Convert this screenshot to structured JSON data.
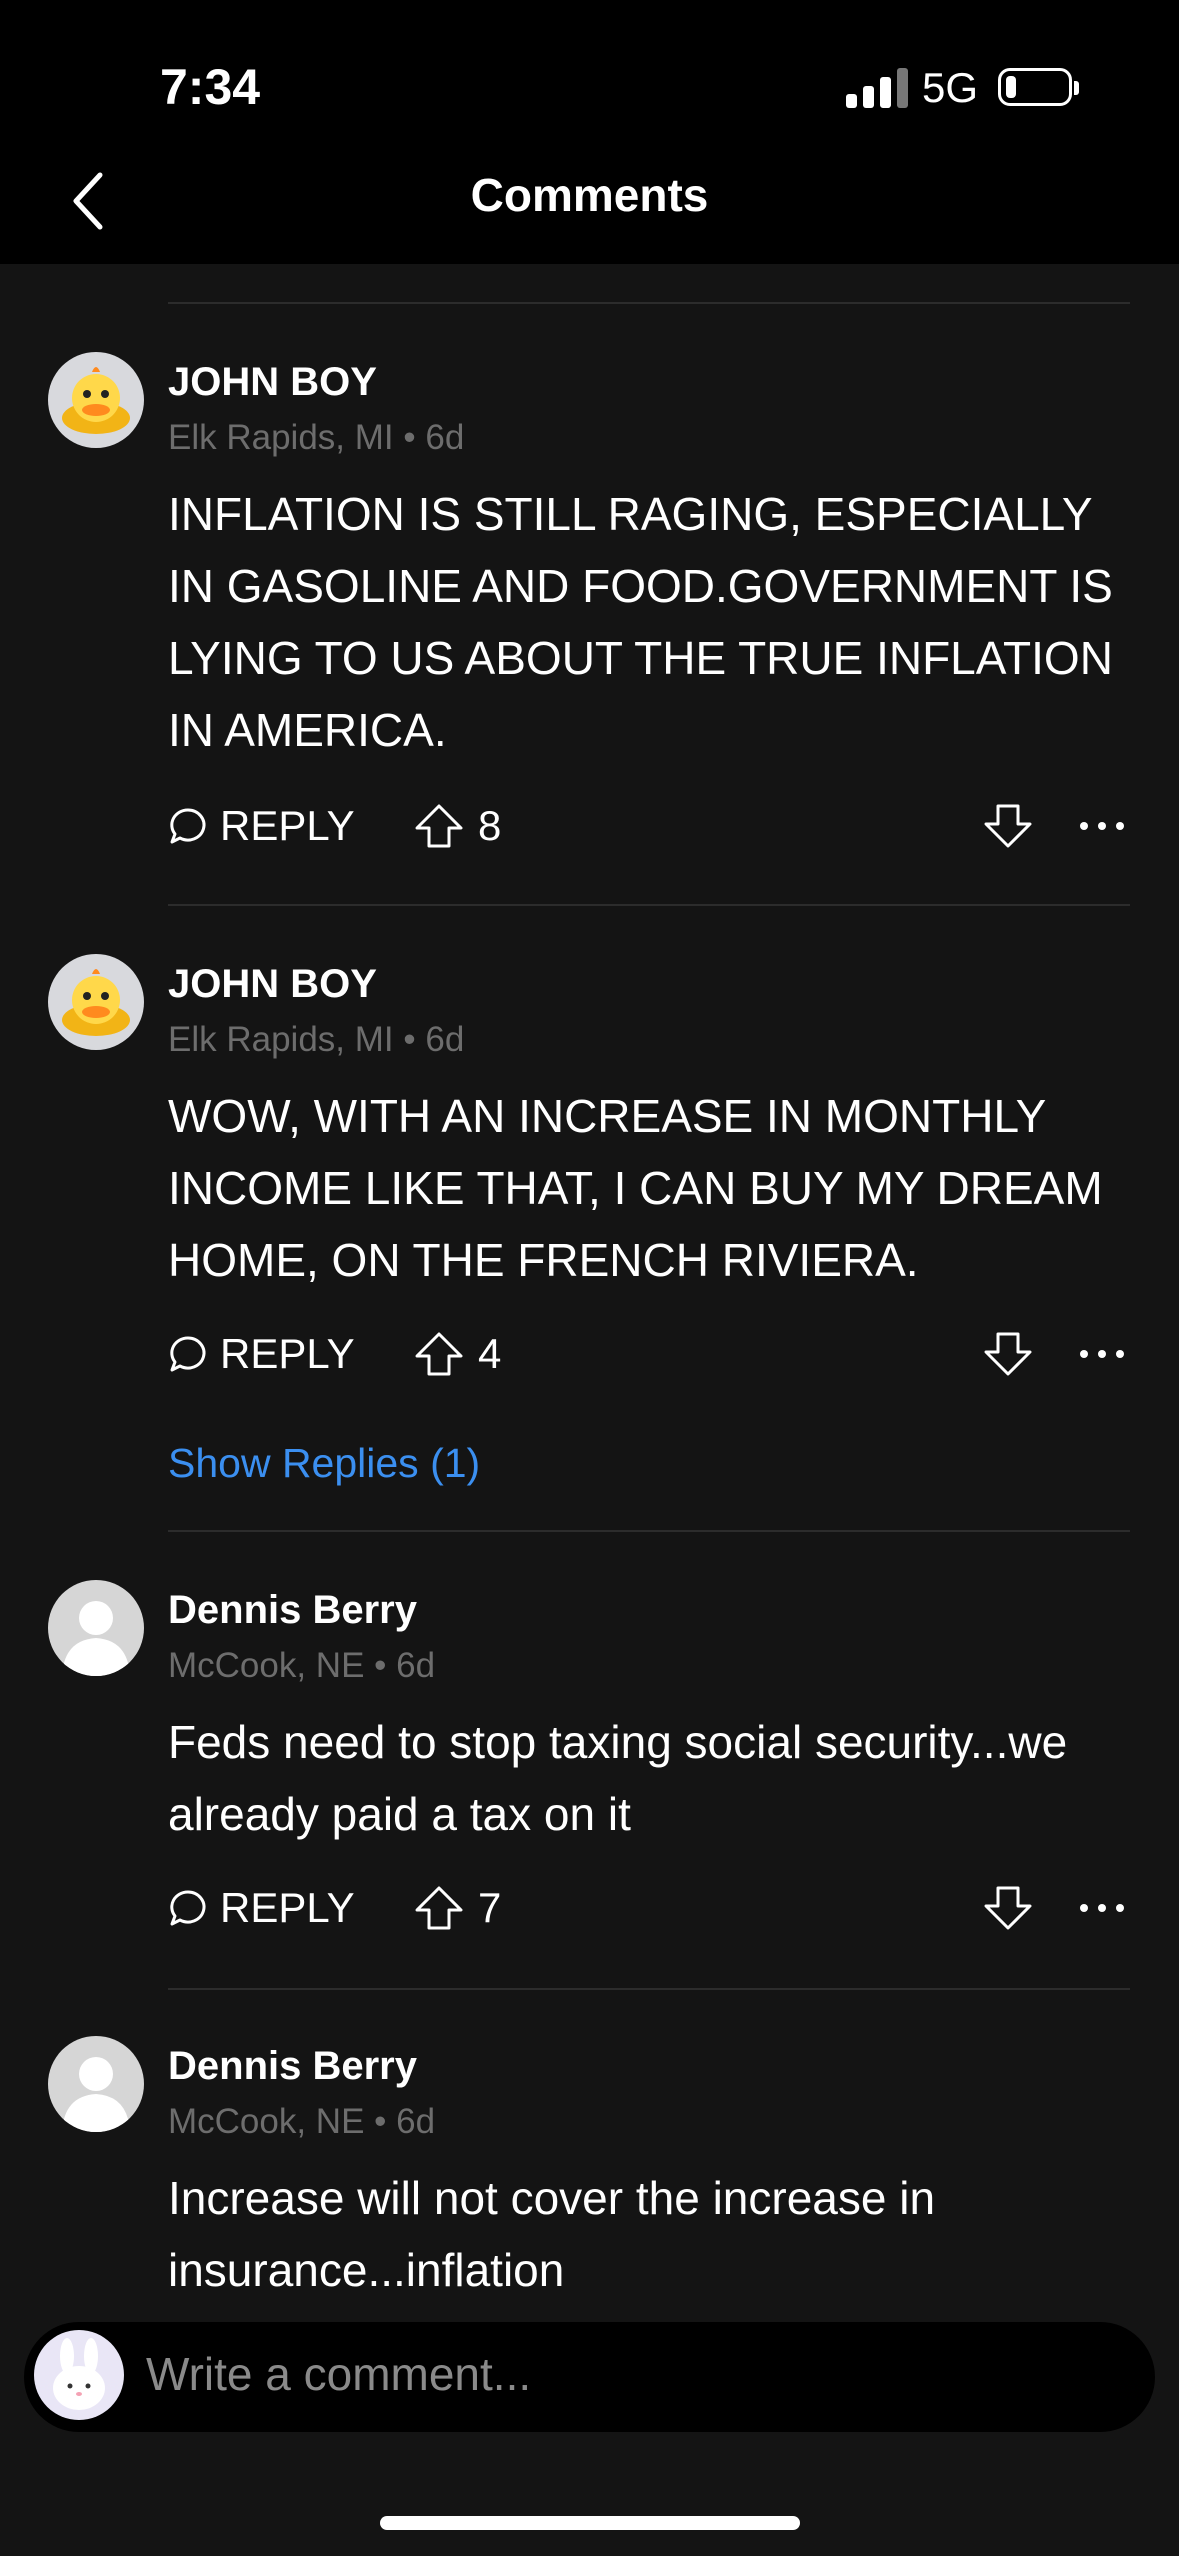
{
  "status_bar": {
    "time": "7:34",
    "network": "5G"
  },
  "header": {
    "title": "Comments"
  },
  "comments": [
    {
      "author": "JOHN BOY",
      "location": "Elk Rapids, MI",
      "age": "6d",
      "text": "INFLATION IS STILL RAGING, ESPECIALLY IN GASOLINE AND FOOD.GOVERNMENT IS LYING TO US ABOUT THE TRUE INFLATION IN AMERICA.",
      "reply_label": "REPLY",
      "upvotes": "8"
    },
    {
      "author": "JOHN BOY",
      "location": "Elk Rapids, MI",
      "age": "6d",
      "text": "WOW, WITH AN INCREASE IN MONTHLY INCOME LIKE THAT, I CAN BUY MY DREAM HOME, ON THE FRENCH RIVIERA.",
      "reply_label": "REPLY",
      "upvotes": "4",
      "show_replies": "Show Replies (1)"
    },
    {
      "author": "Dennis Berry",
      "location": "McCook, NE",
      "age": "6d",
      "text": "Feds need to stop taxing social security...we already paid a tax on it",
      "reply_label": "REPLY",
      "upvotes": "7"
    },
    {
      "author": "Dennis Berry",
      "location": "McCook, NE",
      "age": "6d",
      "text": "Increase will not cover the increase in insurance...inflation"
    }
  ],
  "meta_separator": "•",
  "composer": {
    "placeholder": "Write a comment..."
  },
  "colors": {
    "background": "#141414",
    "bar": "#000000",
    "link": "#3b8ff0",
    "muted": "#6d6d6d"
  }
}
